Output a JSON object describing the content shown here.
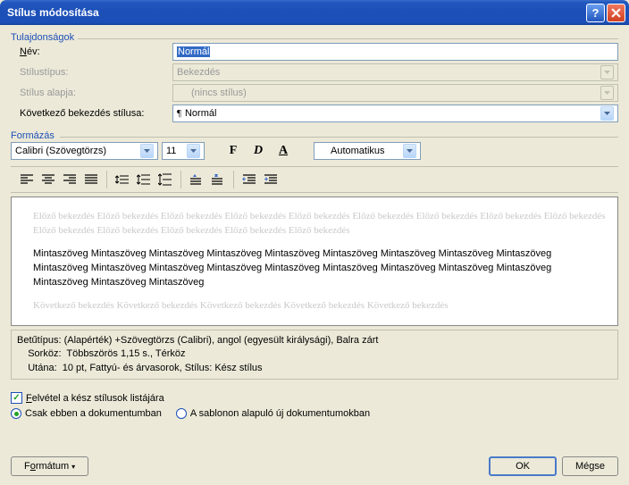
{
  "titlebar": {
    "title": "Stílus módosítása"
  },
  "props": {
    "legend": "Tulajdonságok",
    "name_label": "Név:",
    "name_value": "Normál",
    "type_label": "Stílustípus:",
    "type_value": "Bekezdés",
    "base_label": "Stílus alapja:",
    "base_value": "(nincs stílus)",
    "next_label": "Következő bekezdés stílusa:",
    "next_value": "Normál"
  },
  "format": {
    "legend": "Formázás",
    "font": "Calibri (Szövegtörzs)",
    "size": "11",
    "bold": "F",
    "italic": "D",
    "underline": "A",
    "color": "Automatikus"
  },
  "preview": {
    "prev": "Előző bekezdés Előző bekezdés Előző bekezdés Előző bekezdés Előző bekezdés Előző bekezdés Előző bekezdés Előző bekezdés Előző bekezdés Előző bekezdés Előző bekezdés Előző bekezdés Előző bekezdés Előző bekezdés",
    "main": "Mintaszöveg Mintaszöveg Mintaszöveg Mintaszöveg Mintaszöveg Mintaszöveg Mintaszöveg Mintaszöveg Mintaszöveg Mintaszöveg Mintaszöveg Mintaszöveg Mintaszöveg Mintaszöveg Mintaszöveg Mintaszöveg Mintaszöveg Mintaszöveg Mintaszöveg Mintaszöveg Mintaszöveg",
    "next": "Következő bekezdés Következő bekezdés Következő bekezdés Következő bekezdés Következő bekezdés"
  },
  "desc": {
    "line1": "Betűtípus: (Alapérték) +Szövegtörzs (Calibri), angol (egyesült királysági), Balra zárt",
    "line2": "    Sorköz:  Többszörös 1,15 s., Térköz",
    "line3": "    Utána:  10 pt, Fattyú- és árvasorok, Stílus: Kész stílus"
  },
  "options": {
    "add_to_list": "Felvétel a kész stílusok listájára",
    "only_doc": "Csak ebben a dokumentumban",
    "template": "A sablonon alapuló új dokumentumokban"
  },
  "buttons": {
    "format": "Formátum",
    "ok": "OK",
    "cancel": "Mégse"
  }
}
